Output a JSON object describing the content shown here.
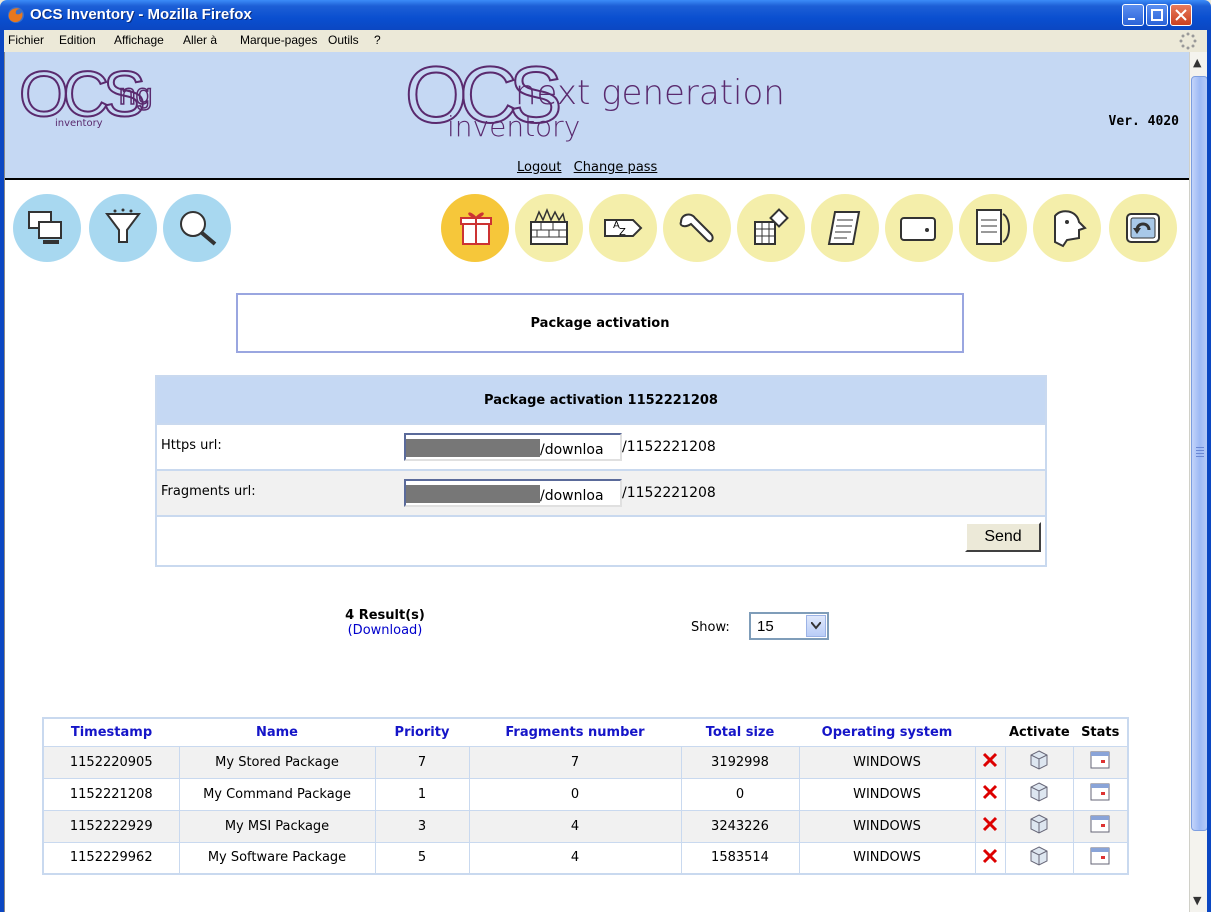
{
  "window": {
    "title": "OCS Inventory - Mozilla Firefox"
  },
  "menu": [
    "Fichier",
    "Edition",
    "Affichage",
    "Aller à",
    "Marque-pages",
    "Outils",
    "?"
  ],
  "header": {
    "logo_small_text": "inventory",
    "logo_big_line1": "next generation",
    "logo_big_line2": "inventory",
    "version": "Ver. 4020",
    "logout": "Logout",
    "change_pass": "Change pass"
  },
  "toolbar_icons": [
    {
      "name": "computers-icon",
      "color": "#a8d8f0"
    },
    {
      "name": "filter-icon",
      "color": "#a8d8f0"
    },
    {
      "name": "search-icon",
      "color": "#a8d8f0"
    },
    {
      "name": "deploy-gift-icon",
      "color": "#f6c73a"
    },
    {
      "name": "firewall-icon",
      "color": "#f4eeaa"
    },
    {
      "name": "dictionary-icon",
      "color": "#f4eeaa"
    },
    {
      "name": "wrench-icon",
      "color": "#f4eeaa"
    },
    {
      "name": "registry-icon",
      "color": "#f4eeaa"
    },
    {
      "name": "scroll-icon",
      "color": "#f4eeaa"
    },
    {
      "name": "tags-icon",
      "color": "#f4eeaa"
    },
    {
      "name": "document-icon",
      "color": "#f4eeaa"
    },
    {
      "name": "help-icon",
      "color": "#f4eeaa"
    },
    {
      "name": "back-icon",
      "color": "#f4eeaa"
    }
  ],
  "page_title": "Package activation",
  "activation": {
    "heading": "Package activation 1152221208",
    "https_label": "Https url:",
    "https_value": "/downloa",
    "https_suffix": "/1152221208",
    "fragments_label": "Fragments url:",
    "fragments_value": "/downloa",
    "fragments_suffix": "/1152221208",
    "send": "Send"
  },
  "results": {
    "count": "4 Result(s)",
    "download": "(Download)",
    "show_label": "Show:",
    "show_value": "15"
  },
  "table": {
    "headers": [
      "Timestamp",
      "Name",
      "Priority",
      "Fragments number",
      "Total size",
      "Operating system",
      "Activate",
      "Stats"
    ],
    "rows": [
      [
        "1152220905",
        "My Stored Package",
        "7",
        "7",
        "3192998",
        "WINDOWS"
      ],
      [
        "1152221208",
        "My Command Package",
        "1",
        "0",
        "0",
        "WINDOWS"
      ],
      [
        "1152222929",
        "My MSI Package",
        "3",
        "4",
        "3243226",
        "WINDOWS"
      ],
      [
        "1152229962",
        "My Software Package",
        "5",
        "4",
        "1583514",
        "WINDOWS"
      ]
    ]
  }
}
